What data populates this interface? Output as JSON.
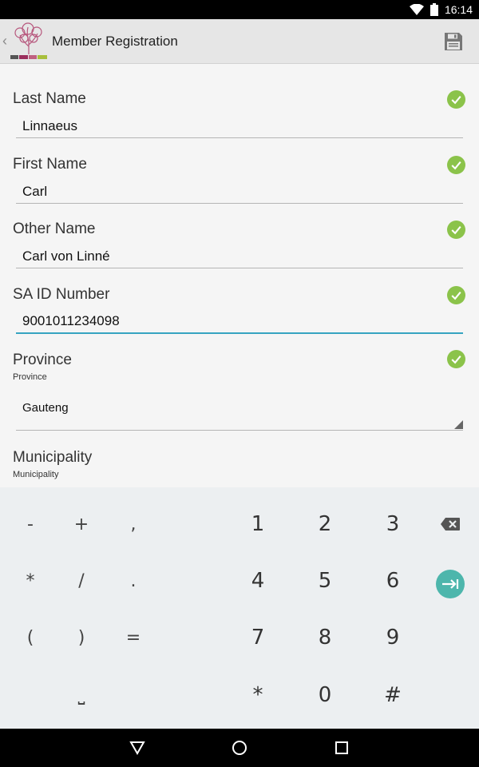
{
  "status_bar": {
    "time": "16:14"
  },
  "action_bar": {
    "title": "Member Registration"
  },
  "form": {
    "fields": [
      {
        "label": "Last Name",
        "value": "Linnaeus"
      },
      {
        "label": "First Name",
        "value": "Carl"
      },
      {
        "label": "Other Name",
        "value": "Carl von Linné"
      },
      {
        "label": "SA ID Number",
        "value": "9001011234098"
      }
    ],
    "province": {
      "label": "Province",
      "sublabel": "Province",
      "selected": "Gauteng"
    },
    "municipality": {
      "label": "Municipality",
      "sublabel": "Municipality"
    }
  },
  "keyboard": {
    "keys": {
      "minus": "-",
      "plus": "+",
      "comma": ",",
      "asterisk": "*",
      "slash": "/",
      "period": ".",
      "lparen": "(",
      "rparen": ")",
      "equals": "=",
      "space": "⎵",
      "one": "1",
      "two": "2",
      "three": "3",
      "four": "4",
      "five": "5",
      "six": "6",
      "seven": "7",
      "eight": "8",
      "nine": "9",
      "star": "*",
      "zero": "0",
      "hash": "#"
    }
  },
  "colors": {
    "accent": "#36a4c1",
    "check": "#8bc34a",
    "next_key": "#4db6ac"
  },
  "icons": [
    "wifi-icon",
    "battery-icon",
    "save-icon",
    "check-icon",
    "backspace-icon",
    "next-field-icon",
    "back-nav-icon",
    "home-nav-icon",
    "recents-nav-icon"
  ]
}
